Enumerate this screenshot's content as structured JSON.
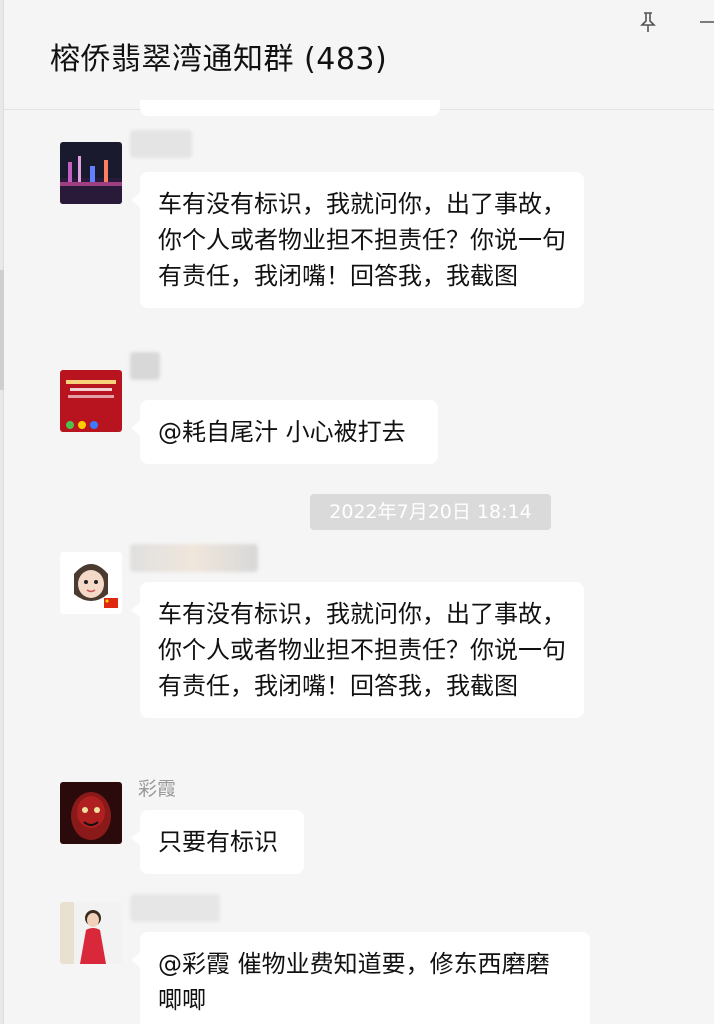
{
  "header": {
    "title": "榕侨翡翠湾通知群 (483)"
  },
  "timestamp": "2022年7月20日 18:14",
  "messages": [
    {
      "sender": "",
      "text": "车有没有标识，我就问你，出了事故，你个人或者物业担不担责任？你说一句有责任，我闭嘴！回答我，我截图"
    },
    {
      "sender": "",
      "text": "@耗自尾汁 小心被打去"
    },
    {
      "sender": "",
      "text": "车有没有标识，我就问你，出了事故，你个人或者物业担不担责任？你说一句有责任，我闭嘴！回答我，我截图"
    },
    {
      "sender": "彩霞",
      "text": "只要有标识"
    },
    {
      "sender": "",
      "text": "@彩霞 催物业费知道要，修东西磨磨唧唧"
    }
  ],
  "colors": {
    "background": "#f5f5f5",
    "bubble": "#ffffff",
    "timestamp_bg": "#dadada",
    "sender_name": "#9a9a9a"
  },
  "icons": [
    "pin-icon",
    "minimize-icon"
  ]
}
